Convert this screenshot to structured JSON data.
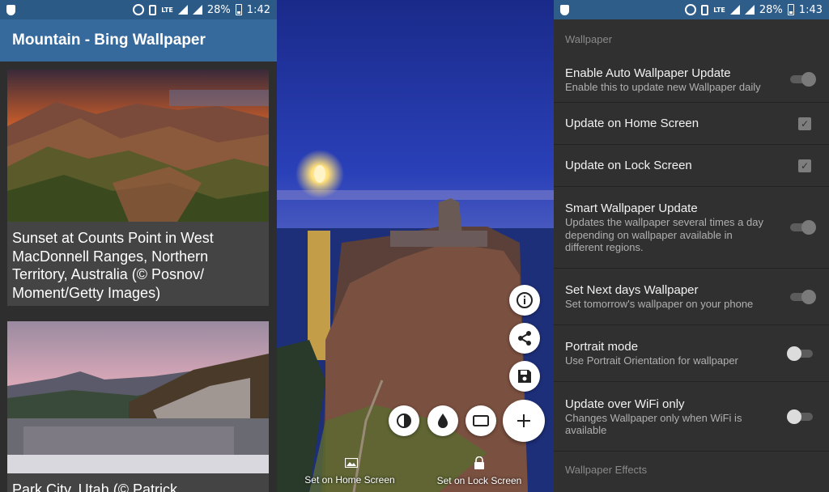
{
  "status_left": {
    "battery": "28%",
    "time": "1:42",
    "network": "LTE"
  },
  "status_right": {
    "battery": "28%",
    "time": "1:43",
    "network": "LTE"
  },
  "list_screen": {
    "app_title": "Mountain - Bing Wallpaper",
    "cards": [
      {
        "caption": "Sunset at Counts Point in West MacDonnell Ranges, Northern Territory, Australia (© Posnov/ Moment/Getty Images)"
      },
      {
        "caption": "Park City, Utah (© Patrick"
      }
    ]
  },
  "preview_screen": {
    "home_label": "Set on Home Screen",
    "lock_label": "Set on Lock Screen",
    "icons": [
      "info-icon",
      "share-icon",
      "save-icon",
      "contrast-icon",
      "drop-icon",
      "crop-icon",
      "plus-icon"
    ]
  },
  "settings_screen": {
    "section_wallpaper": "Wallpaper",
    "section_effects": "Wallpaper Effects",
    "prefs": [
      {
        "title": "Enable Auto Wallpaper Update",
        "summary": "Enable this to update new Wallpaper daily",
        "control": "switch",
        "state": "on-disabled"
      },
      {
        "title": "Update on Home Screen",
        "summary": "",
        "control": "checkbox",
        "state": "checked"
      },
      {
        "title": "Update on Lock Screen",
        "summary": "",
        "control": "checkbox",
        "state": "checked"
      },
      {
        "title": "Smart Wallpaper Update",
        "summary": "Updates the wallpaper several times a day depending on wallpaper available in different regions.",
        "control": "switch",
        "state": "on-disabled"
      },
      {
        "title": "Set Next days Wallpaper",
        "summary": "Set tomorrow's wallpaper on your phone",
        "control": "switch",
        "state": "on-disabled"
      },
      {
        "title": "Portrait mode",
        "summary": "Use Portrait Orientation for wallpaper",
        "control": "switch",
        "state": "off"
      },
      {
        "title": "Update over WiFi only",
        "summary": "Changes Wallpaper only when WiFi is available",
        "control": "switch",
        "state": "off"
      }
    ]
  },
  "colors": {
    "appbar": "#376a9c",
    "statusbar": "#2b5a87",
    "settings_bg": "#303030"
  }
}
